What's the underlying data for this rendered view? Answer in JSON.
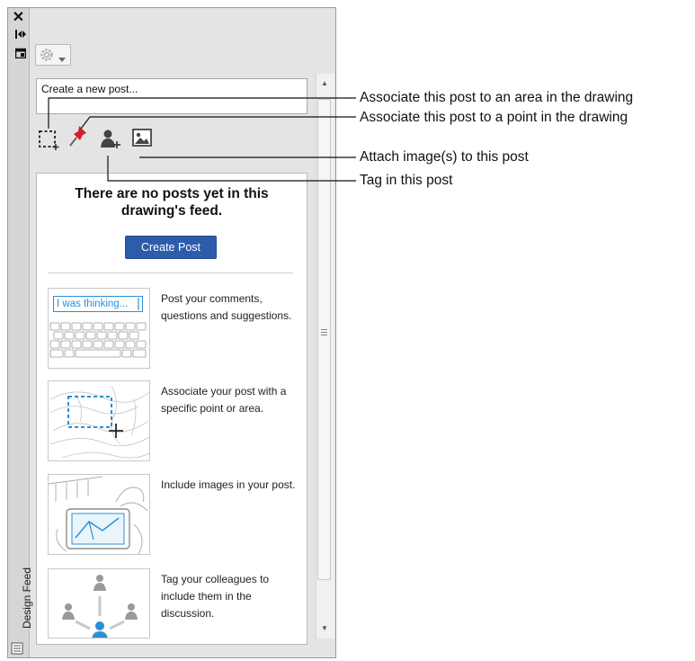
{
  "palette": {
    "vertical_title": "Design Feed",
    "strip_icons": [
      "close-icon",
      "autohide-icon",
      "properties-icon",
      "feed-icon"
    ],
    "settings_button": {
      "icon": "gear-icon",
      "dropdown": "chevron-down-icon"
    }
  },
  "new_post": {
    "placeholder": "Create a new post...",
    "tools": [
      "area-select-icon",
      "pushpin-icon",
      "tag-person-icon",
      "image-icon"
    ]
  },
  "feed": {
    "empty_title": "There are no posts yet in this drawing's feed.",
    "create_post_label": "Create Post",
    "tips": [
      {
        "image_text": "I was thinking...",
        "text": "Post your comments, questions and suggestions."
      },
      {
        "image_text": "",
        "text": "Associate your post with a specific point or area."
      },
      {
        "image_text": "",
        "text": "Include images in your post."
      },
      {
        "image_text": "",
        "text": "Tag your colleagues to include them in the discussion."
      }
    ]
  },
  "callouts": {
    "area": "Associate this post to an area in the drawing",
    "point": "Associate this post to a point in the drawing",
    "image": "Attach image(s) to this post",
    "tag": "Tag in this post"
  },
  "colors": {
    "accent": "#2d5cab",
    "pin_red": "#d01f2c",
    "tip_blue": "#2b8fd6"
  }
}
